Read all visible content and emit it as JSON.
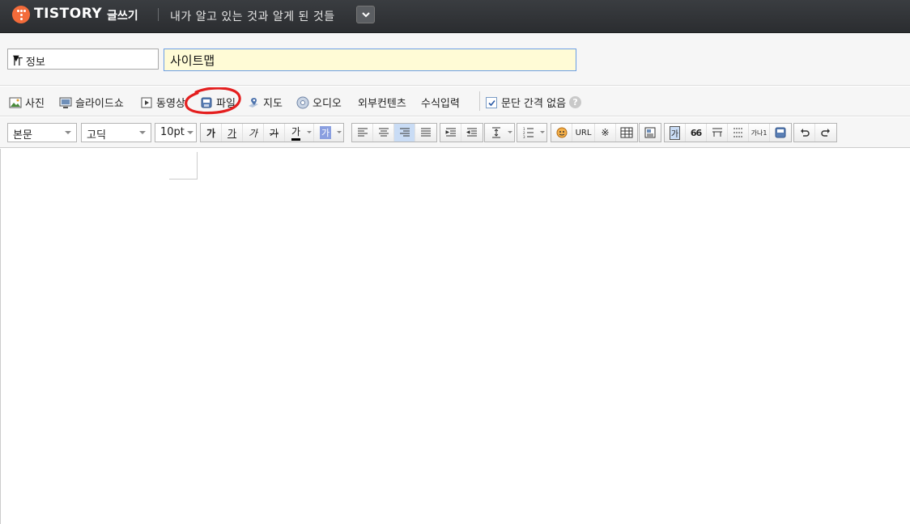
{
  "header": {
    "brand": "TISTORY",
    "section": "글쓰기",
    "blog_title": "내가 알고 있는 것과 알게 된 것들"
  },
  "post": {
    "category": "IT 정보",
    "title_value": "사이트맵"
  },
  "attach_toolbar": {
    "photo": "사진",
    "slideshow": "슬라이드쇼",
    "video": "동영상",
    "file": "파일",
    "map": "지도",
    "audio": "오디오",
    "external": "외부컨텐츠",
    "formula": "수식입력",
    "no_paragraph_spacing": "문단 간격 없음",
    "help": "?"
  },
  "format_toolbar": {
    "paragraph_style": "본문",
    "font": "고딕",
    "font_size": "10pt",
    "bold": "가",
    "underline": "가",
    "italic": "가",
    "strike": "가",
    "text_color": "가",
    "bg_color": "가",
    "url": "URL",
    "reference_mark": "※",
    "box_text": "가",
    "quote": "66",
    "superscript": "가나1"
  },
  "colors": {
    "topbar_bg": "#2f3134",
    "logo_orange": "#f36b3a",
    "title_input_bg": "#fffbd6",
    "title_input_border": "#6b9ee6",
    "annotation_red": "#e41e1e",
    "toolbar_bg": "#f6f6f6"
  }
}
